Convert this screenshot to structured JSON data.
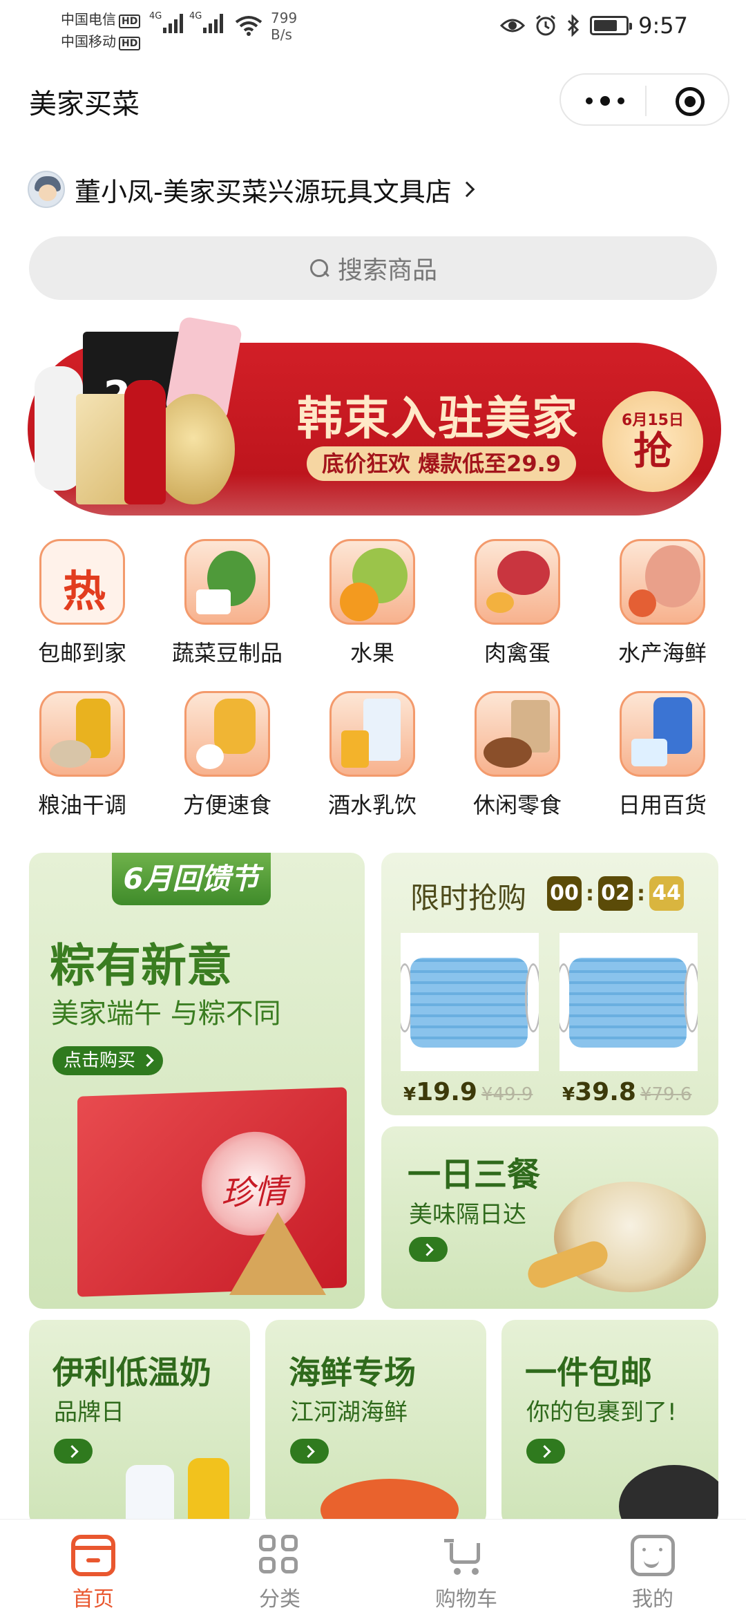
{
  "status_bar": {
    "carrier_1": "中国电信",
    "carrier_2": "中国移动",
    "hd_badge": "HD",
    "network_1": "4G",
    "network_2": "4G",
    "speed_value": "799",
    "speed_unit": "B/s",
    "battery_level": 0.75,
    "time": "9:57",
    "icons": [
      "eye-icon",
      "alarm-icon",
      "bluetooth-icon",
      "battery-icon"
    ]
  },
  "title_bar": {
    "title": "美家买菜",
    "buttons": [
      "more-icon",
      "close-target-icon"
    ]
  },
  "store": {
    "name": "董小凤-美家买菜兴源玩具文具店"
  },
  "search": {
    "placeholder": "搜索商品"
  },
  "banner": {
    "headline": "韩束入驻美家",
    "subline": "底价狂欢 爆款低至29.9",
    "date": "6月15日",
    "action": "抢",
    "product_box_number": "24"
  },
  "categories": [
    {
      "label": "包邮到家",
      "icon": "hot-icon",
      "badge": "热"
    },
    {
      "label": "蔬菜豆制品",
      "icon": "vegetable-icon"
    },
    {
      "label": "水果",
      "icon": "fruit-icon"
    },
    {
      "label": "肉禽蛋",
      "icon": "meat-icon"
    },
    {
      "label": "水产海鲜",
      "icon": "seafood-icon"
    },
    {
      "label": "粮油干调",
      "icon": "grain-oil-icon"
    },
    {
      "label": "方便速食",
      "icon": "instant-food-icon"
    },
    {
      "label": "酒水乳饮",
      "icon": "drinks-icon"
    },
    {
      "label": "休闲零食",
      "icon": "snacks-icon"
    },
    {
      "label": "日用百货",
      "icon": "daily-goods-icon"
    }
  ],
  "promo_festival": {
    "ribbon": "6月回馈节",
    "title": "粽有新意",
    "subtitle": "美家端午 与粽不同",
    "button": "点击购买",
    "gift_text": "珍情"
  },
  "flash_sale": {
    "title": "限时抢购",
    "timer": [
      "00",
      "02",
      "44"
    ],
    "currency": "¥",
    "products": [
      {
        "price": "19.9",
        "old_price": "¥49.9",
        "icon": "face-mask-icon"
      },
      {
        "price": "39.8",
        "old_price": "¥79.6",
        "icon": "face-mask-icon"
      }
    ]
  },
  "meal_card": {
    "title": "一日三餐",
    "subtitle": "美味隔日达"
  },
  "small_cards": [
    {
      "title": "伊利低温奶",
      "subtitle": "品牌日"
    },
    {
      "title": "海鲜专场",
      "subtitle": "江河湖海鲜"
    },
    {
      "title": "一件包邮",
      "subtitle": "你的包裹到了!"
    }
  ],
  "tab_bar": [
    {
      "label": "首页",
      "icon": "home-icon",
      "active": true
    },
    {
      "label": "分类",
      "icon": "category-icon",
      "active": false
    },
    {
      "label": "购物车",
      "icon": "cart-icon",
      "active": false
    },
    {
      "label": "我的",
      "icon": "profile-icon",
      "active": false
    }
  ],
  "colors": {
    "accent": "#e9572f",
    "banner_red": "#c8161f",
    "promo_green": "#2f7a1e",
    "timer_dark": "#5b4b08",
    "timer_gold": "#d9b53f"
  }
}
